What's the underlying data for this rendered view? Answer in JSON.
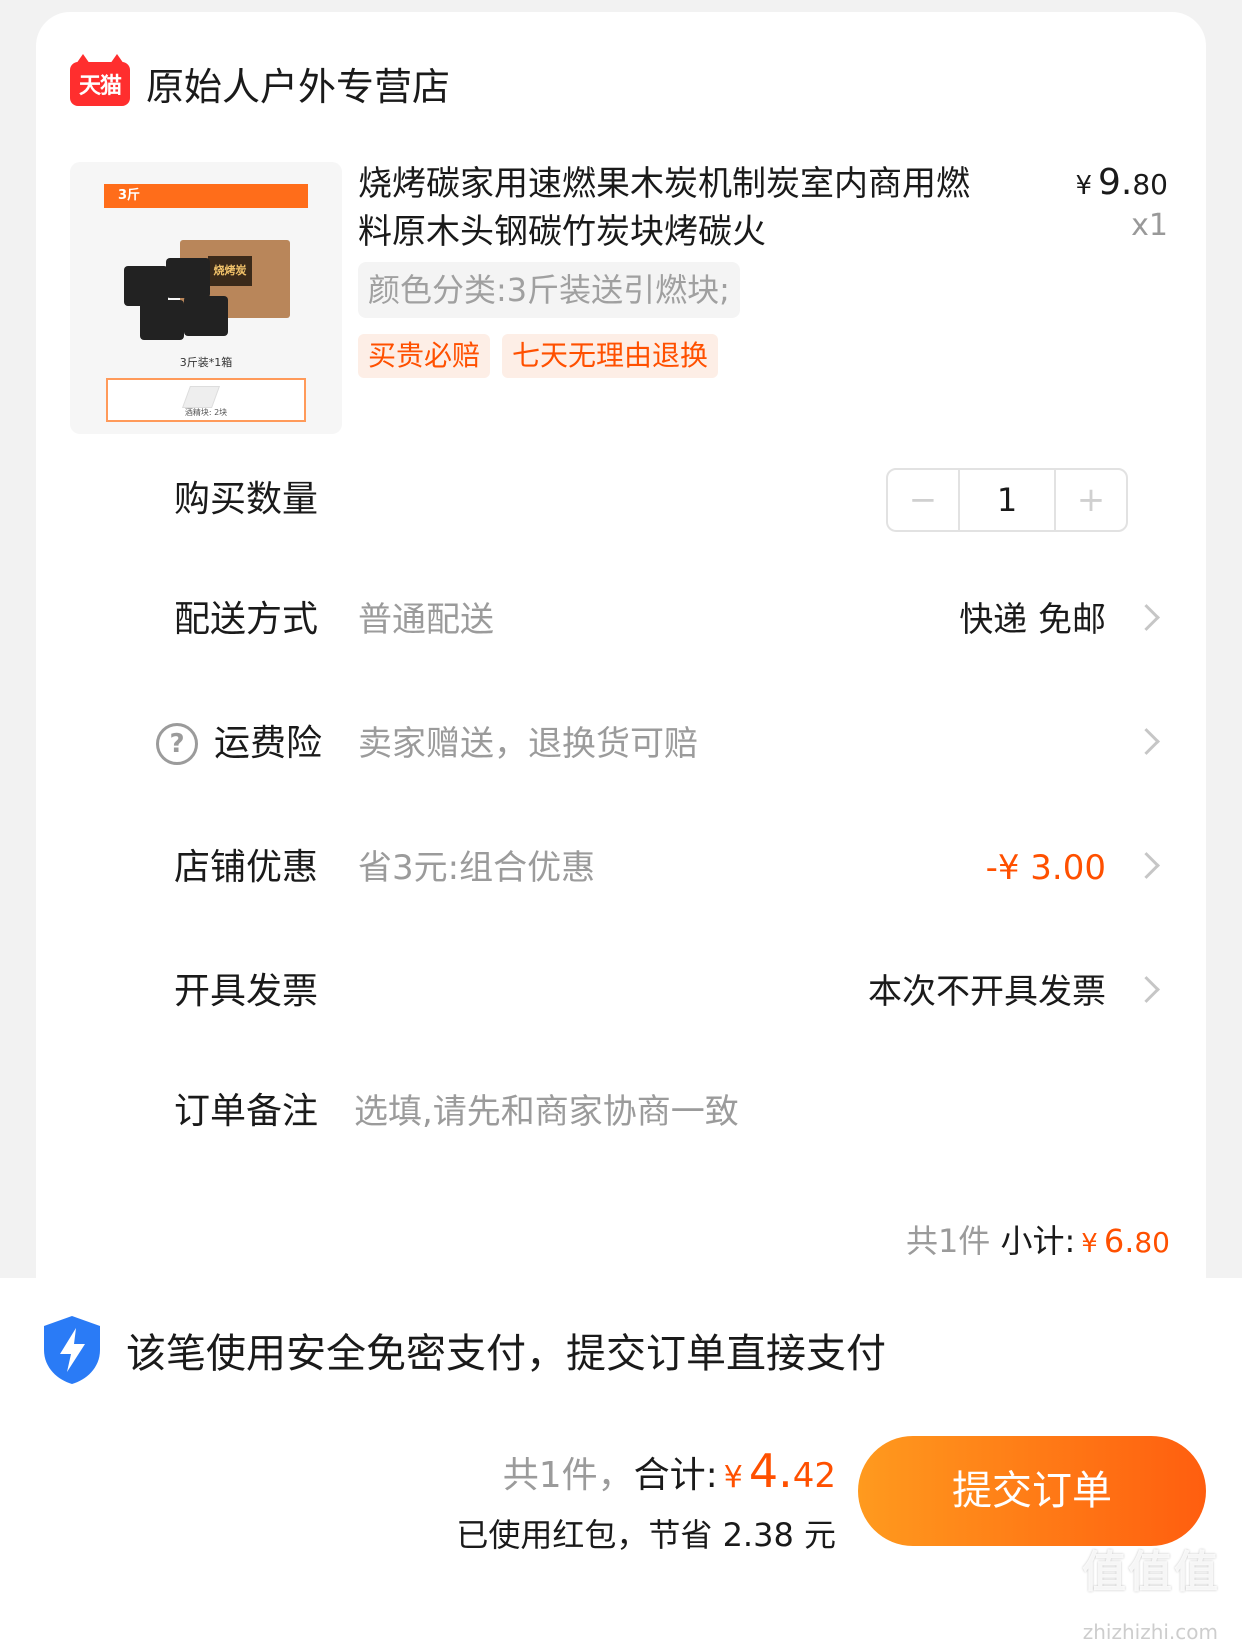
{
  "shop": {
    "badge": "天猫",
    "name": "原始人户外专营店"
  },
  "product": {
    "image": {
      "banner": "3斤",
      "box_label": "烧烤炭",
      "caption": "3斤装*1箱",
      "ignition_label": "酒精块: 2块"
    },
    "title": "烧烤碳家用速燃果木炭机制炭室内商用燃料原木头钢碳竹炭块烤碳火",
    "price_symbol": "¥",
    "price_int": "9.",
    "price_dec": "80",
    "quantity": "x1",
    "variant": "颜色分类:3斤装送引燃块;",
    "tags": [
      "买贵必赔",
      "七天无理由退换"
    ]
  },
  "rows": {
    "quantity": {
      "label": "购买数量",
      "minus": "−",
      "value": "1",
      "plus": "+"
    },
    "delivery": {
      "label": "配送方式",
      "value": "普通配送",
      "right": "快递 免邮"
    },
    "insurance": {
      "help": "?",
      "label": "运费险",
      "value": "卖家赠送，退换货可赔"
    },
    "discount": {
      "label": "店铺优惠",
      "value": "省3元:组合优惠",
      "right": "-¥ 3.00"
    },
    "invoice": {
      "label": "开具发票",
      "right": "本次不开具发票"
    },
    "note": {
      "label": "订单备注",
      "placeholder": "选填,请先和商家协商一致"
    }
  },
  "subtotal": {
    "count": "共1件",
    "label": "小计:",
    "symbol": "¥",
    "int": "6.",
    "dec": "80"
  },
  "bottom": {
    "secure_text": "该笔使用安全免密支付，提交订单直接支付",
    "count": "共1件，",
    "total_label": "合计:",
    "symbol": "¥",
    "int": "4.",
    "dec": "42",
    "saved": "已使用红包，节省 2.38 元",
    "submit": "提交订单"
  },
  "watermark": {
    "text": "值值值",
    "sub": "zhizhizhi.com"
  },
  "colors": {
    "accent": "#ff5000",
    "button_start": "#ff9a1e",
    "button_end": "#ff5e0f",
    "tmall_red": "#ff2e2e",
    "shield_blue": "#2a7bf6"
  }
}
